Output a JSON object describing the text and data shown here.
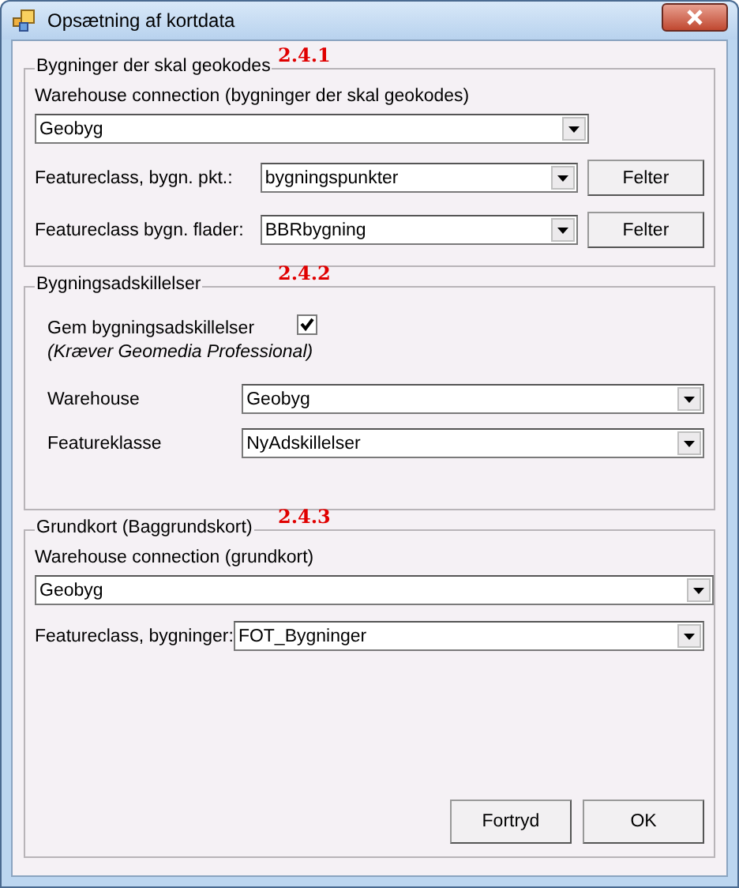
{
  "window": {
    "title": "Opsætning af kortdata"
  },
  "groups": [
    {
      "legend": "Bygninger der skal geokodes",
      "annotation": "2.4.1",
      "fields": [
        {
          "kind": "stacked",
          "label": "Warehouse connection (bygninger der skal geokodes)",
          "value": "Geobyg"
        },
        {
          "kind": "inline",
          "label": "Featureclass, bygn. pkt.:",
          "value": "bygningspunkter",
          "button": "Felter"
        },
        {
          "kind": "inline",
          "label": "Featureclass bygn. flader:",
          "value": "BBRbygning",
          "button": "Felter"
        }
      ]
    },
    {
      "legend": "Bygningsadskillelser",
      "annotation": "2.4.2",
      "fields": [
        {
          "kind": "checkbox",
          "label": "Gem bygningsadskillelser",
          "checked": true,
          "note": "(Kræver Geomedia Professional)"
        },
        {
          "kind": "inline",
          "label": "Warehouse",
          "value": "Geobyg"
        },
        {
          "kind": "inline",
          "label": "Featureklasse",
          "value": "NyAdskillelser"
        }
      ]
    },
    {
      "legend": "Grundkort (Baggrundskort)",
      "annotation": "2.4.3",
      "fields": [
        {
          "kind": "stacked",
          "label": "Warehouse connection (grundkort)",
          "value": "Geobyg"
        },
        {
          "kind": "inline",
          "label": "Featureclass, bygninger:",
          "value": "FOT_Bygninger"
        }
      ]
    }
  ],
  "buttons": [
    "Fortryd",
    "OK"
  ]
}
